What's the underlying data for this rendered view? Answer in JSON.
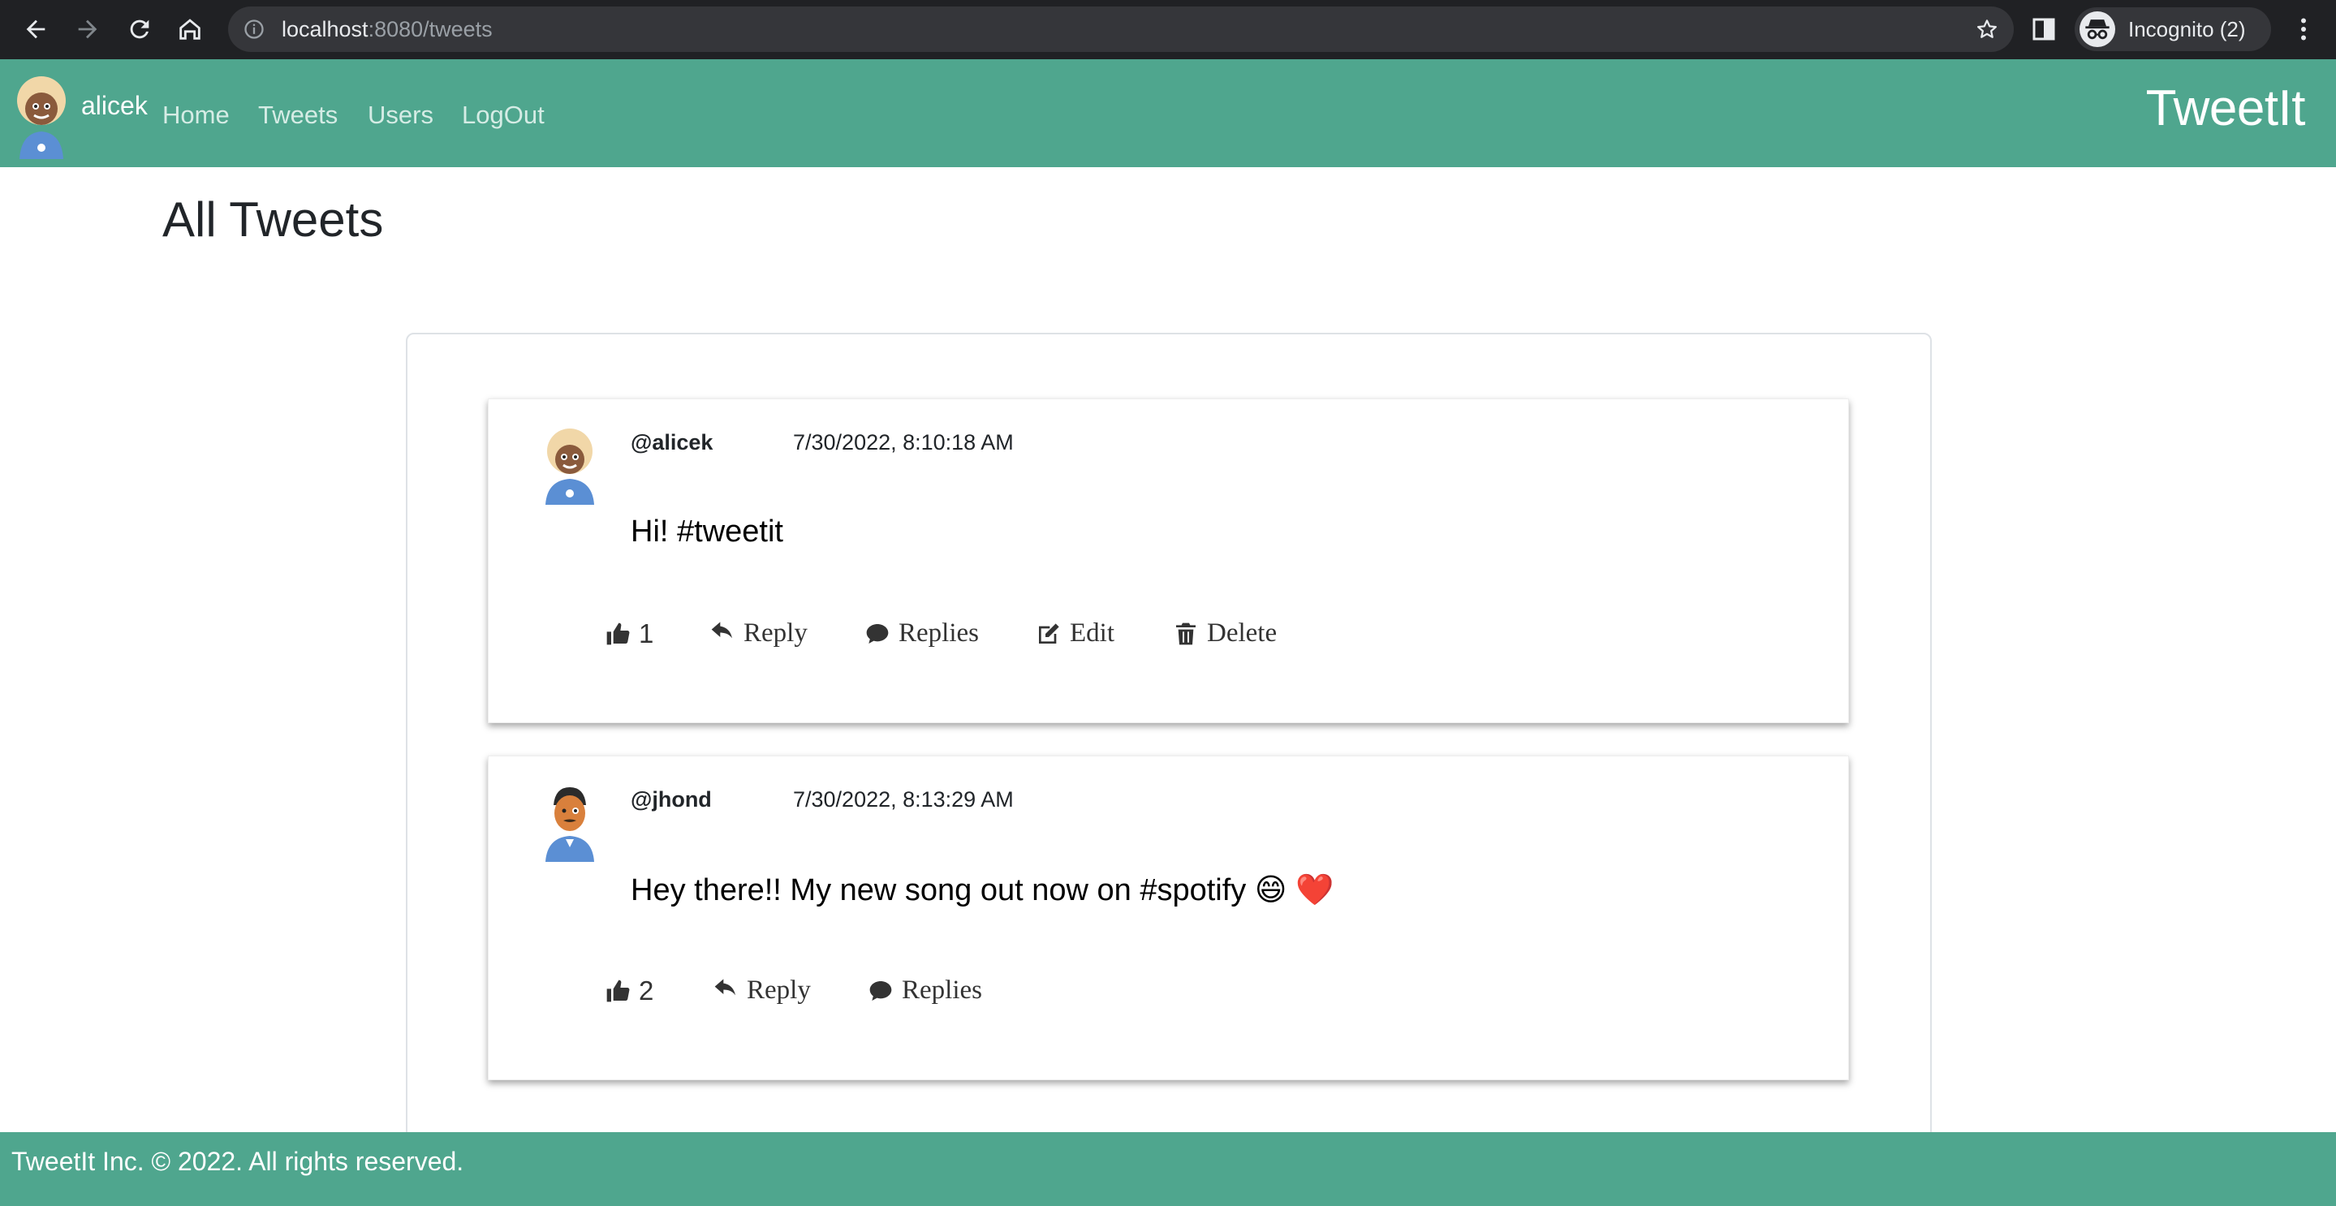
{
  "browser": {
    "url_host": "localhost",
    "url_path": ":8080/tweets",
    "profile_label": "Incognito (2)"
  },
  "nav": {
    "username": "alicek",
    "links": [
      "Home",
      "Tweets",
      "Users",
      "LogOut"
    ],
    "brand": "TweetIt"
  },
  "page": {
    "title": "All Tweets"
  },
  "tweets": [
    {
      "handle": "@alicek",
      "time": "7/30/2022, 8:10:18 AM",
      "text": "Hi! #tweetit",
      "likes": "1",
      "reply_label": "Reply",
      "replies_label": "Replies",
      "edit_label": "Edit",
      "delete_label": "Delete"
    },
    {
      "handle": "@jhond",
      "time": "7/30/2022, 8:13:29 AM",
      "text": "Hey there!! My new song out now on #spotify 😄 ❤️",
      "likes": "2",
      "reply_label": "Reply",
      "replies_label": "Replies"
    }
  ],
  "footer": {
    "text": "TweetIt Inc. © 2022. All rights reserved."
  },
  "colors": {
    "brand_green": "#4fa68e",
    "chrome_dark": "#202124"
  }
}
